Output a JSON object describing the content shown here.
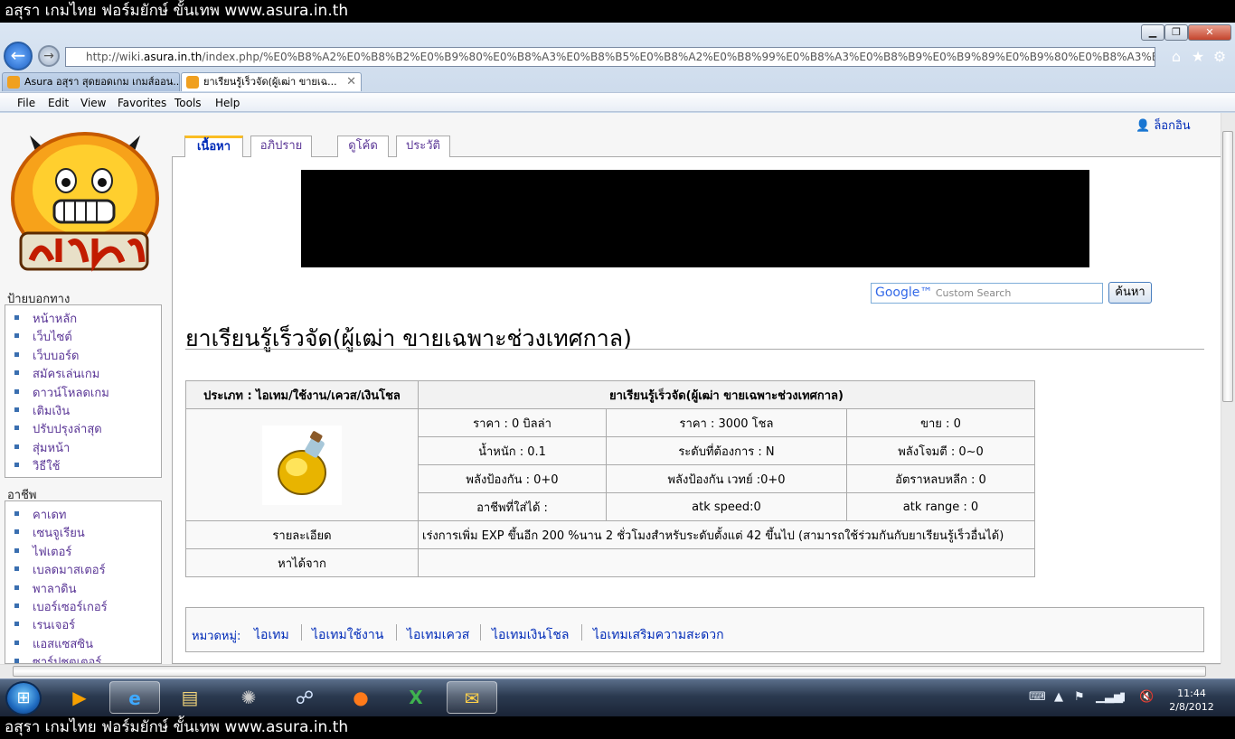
{
  "banner": {
    "text": "อสุรา เกมไทย ฟอร์มยักษ์ ขั้นเทพ www.asura.in.th"
  },
  "browser": {
    "url_prefix": "http://wiki.",
    "url_host": "asura.in.th",
    "url_rest": "/index.php/%E0%B8%A2%E0%B8%B2%E0%B9%80%E0%B8%A3%E0%B8%B5%E0%B8%A2%E0%B8%99%E0%B8%A3%E0%B8%B9%E0%B9%89%E0%B9%80%E0%B8%A3%E0%B9%87%E0%B8",
    "tabs": [
      {
        "label": "Asura อสุรา สุดยอดเกม เกมส์ออน..."
      },
      {
        "label": "ยาเรียนรู้เร็วจัด(ผู้เฒ่า ขายเฉ..."
      }
    ],
    "menu": [
      "File",
      "Edit",
      "View",
      "Favorites",
      "Tools",
      "Help"
    ]
  },
  "wiki": {
    "login_label": "ล็อกอิน",
    "content_tabs": [
      "เนื้อหา",
      "อภิปราย",
      "ดูโค้ด",
      "ประวัติ"
    ],
    "search": {
      "placeholder_brand": "Google™",
      "placeholder": "Custom Search",
      "button": "ค้นหา"
    },
    "sidebar": {
      "nav_title": "ป้ายบอกทาง",
      "nav_items": [
        "หน้าหลัก",
        "เว็บไซต์",
        "เว็บบอร์ด",
        "สมัครเล่นเกม",
        "ดาวน์โหลดเกม",
        "เติมเงิน",
        "ปรับปรุงล่าสุด",
        "สุ่มหน้า",
        "วิธีใช้"
      ],
      "class_title": "อาชีพ",
      "class_items": [
        "คาเดท",
        "เซนจูเรียน",
        "ไฟเตอร์",
        "เบลดมาสเตอร์",
        "พาลาดิน",
        "เบอร์เซอร์เกอร์",
        "เรนเจอร์",
        "แอสแซสซิน",
        "ซาร์ปชูตเตอร์"
      ]
    },
    "page_title": "ยาเรียนรู้เร็วจัด(ผู้เฒ่า ขายเฉพาะช่วงเทศกาล)",
    "item": {
      "type_label": "ประเภท : ไอเทม/ใช้งาน/เควส/เงินโชล",
      "name": "ยาเรียนรู้เร็วจัด(ผู้เฒ่า ขายเฉพาะช่วงเทศกาล)",
      "stats": [
        [
          "ราคา : 0 บิลล่า",
          "ราคา : 3000 โชล",
          "ขาย : 0"
        ],
        [
          "น้ำหนัก : 0.1",
          "ระดับที่ต้องการ : N",
          "พลังโจมตี : 0~0"
        ],
        [
          "พลังป้องกัน : 0+0",
          "พลังป้องกัน เวทย์ :0+0",
          "อัตราหลบหลีก : 0"
        ],
        [
          "อาชีพที่ใส่ได้ :",
          "atk speed:0",
          "atk range : 0"
        ]
      ],
      "detail_label": "รายละเอียด",
      "detail_value": "เร่งการเพิ่ม EXP ขึ้นอีก 200 %นาน 2 ชั่วโมงสำหรับระดับตั้งแต่ 42 ขึ้นไป (สามารถใช้ร่วมกันกับยาเรียนรู้เร็วอื่นได้)",
      "source_label": "หาได้จาก",
      "source_value": ""
    },
    "categories": {
      "label": "หมวดหมู่:",
      "items": [
        "ไอเทม",
        "ไอเทมใช้งาน",
        "ไอเทมเควส",
        "ไอเทมเงินโชล",
        "ไอเทมเสริมความสะดวก"
      ]
    }
  },
  "taskbar": {
    "time": "11:44",
    "date": "2/8/2012"
  }
}
